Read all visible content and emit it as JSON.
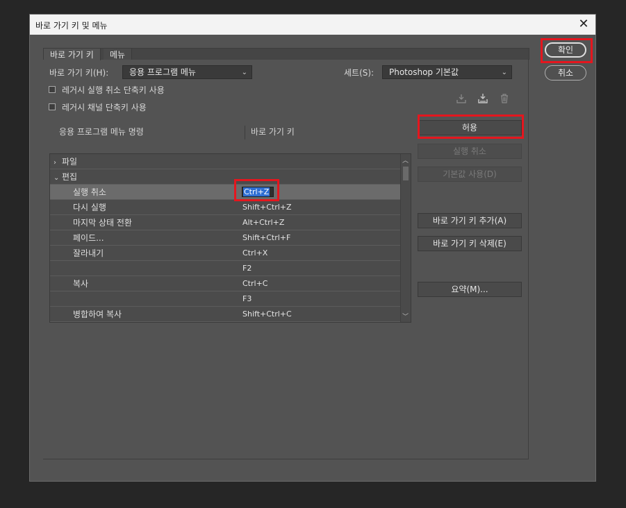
{
  "window": {
    "title": "바로 가기 키 및 메뉴"
  },
  "tabs": [
    {
      "label": "바로 가기 키"
    },
    {
      "label": "메뉴"
    }
  ],
  "shortcuts_for": {
    "label": "바로 가기 키(H):",
    "value": "응용 프로그램 메뉴"
  },
  "set": {
    "label": "세트(S):",
    "value": "Photoshop 기본값"
  },
  "options": [
    {
      "label": "레거시 실행 취소 단축키 사용",
      "checked": false
    },
    {
      "label": "레거시 채널 단축키 사용",
      "checked": false
    }
  ],
  "columns": {
    "command": "응용 프로그램 메뉴 명령",
    "shortcut": "바로 가기 키"
  },
  "rows": [
    {
      "type": "group",
      "arrow": "›",
      "name": "파일",
      "key": ""
    },
    {
      "type": "group",
      "arrow": "⌄",
      "name": "편집",
      "key": ""
    },
    {
      "type": "item",
      "name": "실행 취소",
      "key": "Ctrl+Z",
      "selected": true,
      "editing": true
    },
    {
      "type": "item",
      "name": "다시 실행",
      "key": "Shift+Ctrl+Z"
    },
    {
      "type": "item",
      "name": "마지막 상태 전환",
      "key": "Alt+Ctrl+Z"
    },
    {
      "type": "item",
      "name": "페이드...",
      "key": "Shift+Ctrl+F"
    },
    {
      "type": "item",
      "name": "잘라내기",
      "key": "Ctrl+X"
    },
    {
      "type": "item",
      "name": "",
      "key": "F2"
    },
    {
      "type": "item",
      "name": "복사",
      "key": "Ctrl+C"
    },
    {
      "type": "item",
      "name": "",
      "key": "F3"
    },
    {
      "type": "item",
      "name": "병합하여 복사",
      "key": "Shift+Ctrl+C"
    }
  ],
  "buttons": {
    "accept": "허용",
    "undo": "실행 취소",
    "use_default": "기본값 사용(D)",
    "add_shortcut": "바로 가기 키 추가(A)",
    "delete_shortcut": "바로 가기 키 삭제(E)",
    "summarize": "요약(M)..."
  },
  "dialog_buttons": {
    "ok": "확인",
    "cancel": "취소"
  },
  "icons": {
    "save_set": "save-set-icon",
    "save_set_as": "save-set-as-icon",
    "delete_set": "trash-icon"
  },
  "highlight_color": "#e5161e"
}
